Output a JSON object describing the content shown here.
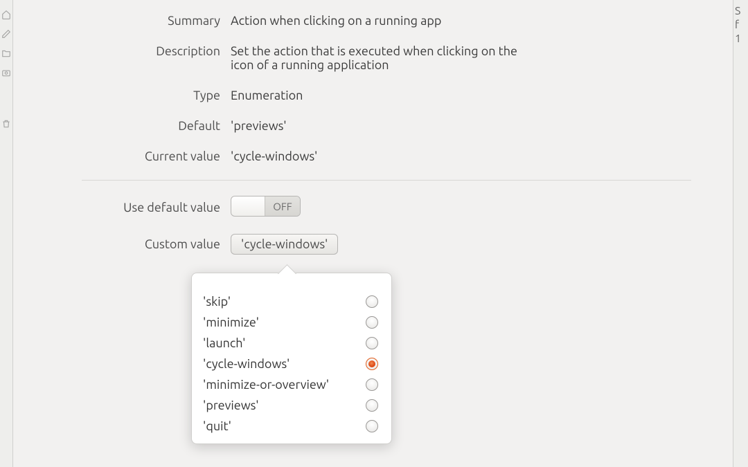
{
  "summary_label": "Summary",
  "summary_value": "Action when clicking on a running app",
  "description_label": "Description",
  "description_value": "Set the action that is executed when clicking on the icon of a running application",
  "type_label": "Type",
  "type_value": "Enumeration",
  "default_label": "Default",
  "default_value": "'previews'",
  "current_label": "Current value",
  "current_value": "'cycle-windows'",
  "use_default_label": "Use default value",
  "toggle_state": "OFF",
  "custom_value_label": "Custom value",
  "custom_value_selected": "'cycle-windows'",
  "options": [
    {
      "label": "'skip'",
      "selected": false
    },
    {
      "label": "'minimize'",
      "selected": false
    },
    {
      "label": "'launch'",
      "selected": false
    },
    {
      "label": "'cycle-windows'",
      "selected": true
    },
    {
      "label": "'minimize-or-overview'",
      "selected": false
    },
    {
      "label": "'previews'",
      "selected": false
    },
    {
      "label": "'quit'",
      "selected": false
    }
  ],
  "right_stub": [
    "S",
    "f",
    "1"
  ]
}
